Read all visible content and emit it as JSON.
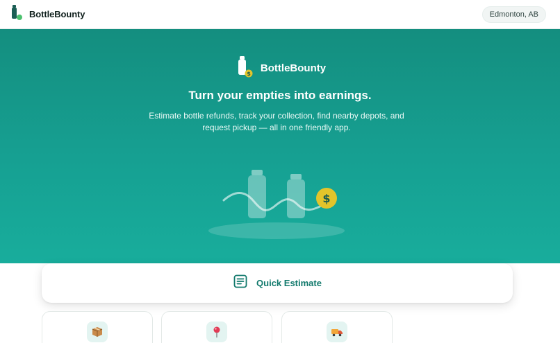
{
  "header": {
    "brand_name": "BottleBounty",
    "location": "Edmonton, AB"
  },
  "hero": {
    "brand_name": "BottleBounty",
    "title": "Turn your empties into earnings.",
    "subtitle": "Estimate bottle refunds, track your collection, find nearby depots, and request pickup — all in one friendly app.",
    "coin_symbol": "$"
  },
  "quick_estimate": {
    "label": "Quick Estimate",
    "icon": "receipt-icon"
  },
  "features": [
    {
      "icon": "package-icon"
    },
    {
      "icon": "map-pin-icon"
    },
    {
      "icon": "truck-icon"
    }
  ],
  "colors": {
    "brand_teal": "#148e7f",
    "hero_light": "#18ad9c",
    "accent_green": "#11796c",
    "coin_yellow": "#e2c42b"
  }
}
